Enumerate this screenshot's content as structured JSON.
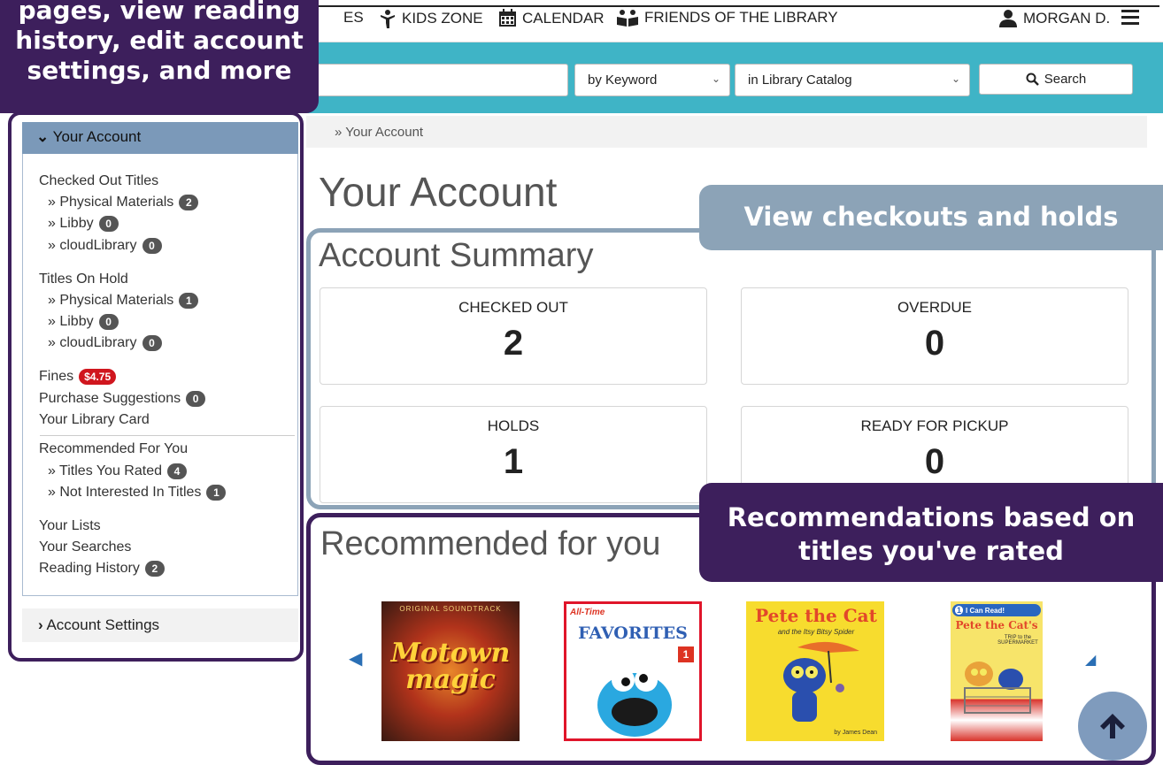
{
  "nav": {
    "items": [
      {
        "label": "ES",
        "icon": "none"
      },
      {
        "label": "KIDS ZONE",
        "icon": "kids-icon"
      },
      {
        "label": "CALENDAR",
        "icon": "calendar-icon"
      },
      {
        "label": "FRIENDS OF THE LIBRARY",
        "icon": "friends-icon"
      }
    ],
    "user": "MORGAN D.",
    "menu_icon": "hamburger-menu-icon"
  },
  "search": {
    "placeholder": "",
    "type_select": "by Keyword",
    "scope_select": "in Library Catalog",
    "button_label": "Search"
  },
  "sidebar": {
    "header": "Your Account",
    "sections": {
      "checked_out": "Checked Out Titles",
      "co_physical": "» Physical Materials",
      "co_physical_count": "2",
      "co_libby": "» Libby",
      "co_libby_count": "0",
      "co_cloud": "» cloudLibrary",
      "co_cloud_count": "0",
      "on_hold": "Titles On Hold",
      "h_physical": "» Physical Materials",
      "h_physical_count": "1",
      "h_libby": "» Libby",
      "h_libby_count": "0",
      "h_cloud": "» cloudLibrary",
      "h_cloud_count": "0",
      "fines": "Fines",
      "fines_amount": "$4.75",
      "purchase": "Purchase Suggestions",
      "purchase_count": "0",
      "library_card": "Your Library Card",
      "recommended": "Recommended For You",
      "rated": "» Titles You Rated",
      "rated_count": "4",
      "not_interested": "» Not Interested In Titles",
      "not_interested_count": "1",
      "lists": "Your Lists",
      "searches": "Your Searches",
      "reading_history": "Reading History",
      "reading_history_count": "2"
    },
    "account_settings": "Account Settings"
  },
  "callouts": {
    "top": [
      "pages, view reading",
      "history, edit account",
      "settings, and more"
    ],
    "checkouts": "View checkouts and holds",
    "recommendations": [
      "Recommendations based on",
      "titles you've rated"
    ]
  },
  "main": {
    "breadcrumb": "» Your Account",
    "title": "Your Account",
    "summary_title": "Account Summary",
    "stats": [
      {
        "label": "CHECKED OUT",
        "value": "2"
      },
      {
        "label": "OVERDUE",
        "value": "0"
      },
      {
        "label": "HOLDS",
        "value": "1"
      },
      {
        "label": "READY FOR PICKUP",
        "value": "0"
      }
    ],
    "recommended_title": "Recommended for you",
    "books": [
      {
        "cover_text": "Motown magic",
        "top_text": "ORIGINAL SOUNDTRACK"
      },
      {
        "cover_text": "FAVORITES",
        "top_text": "All-Time",
        "badge": "1"
      },
      {
        "cover_text": "Pete the Cat",
        "sub_text": "and the Itsy Bitsy Spider",
        "author": "by James Dean"
      },
      {
        "cover_text": "Pete the Cat's",
        "top_text": "I Can Read!",
        "level": "1",
        "sub_text": "TRIP to the SUPERMARKET"
      }
    ]
  },
  "colors": {
    "teal": "#3fb4c6",
    "purple": "#3d1f5c",
    "slate": "#8ca3b7",
    "fines_red": "#d0161e"
  }
}
